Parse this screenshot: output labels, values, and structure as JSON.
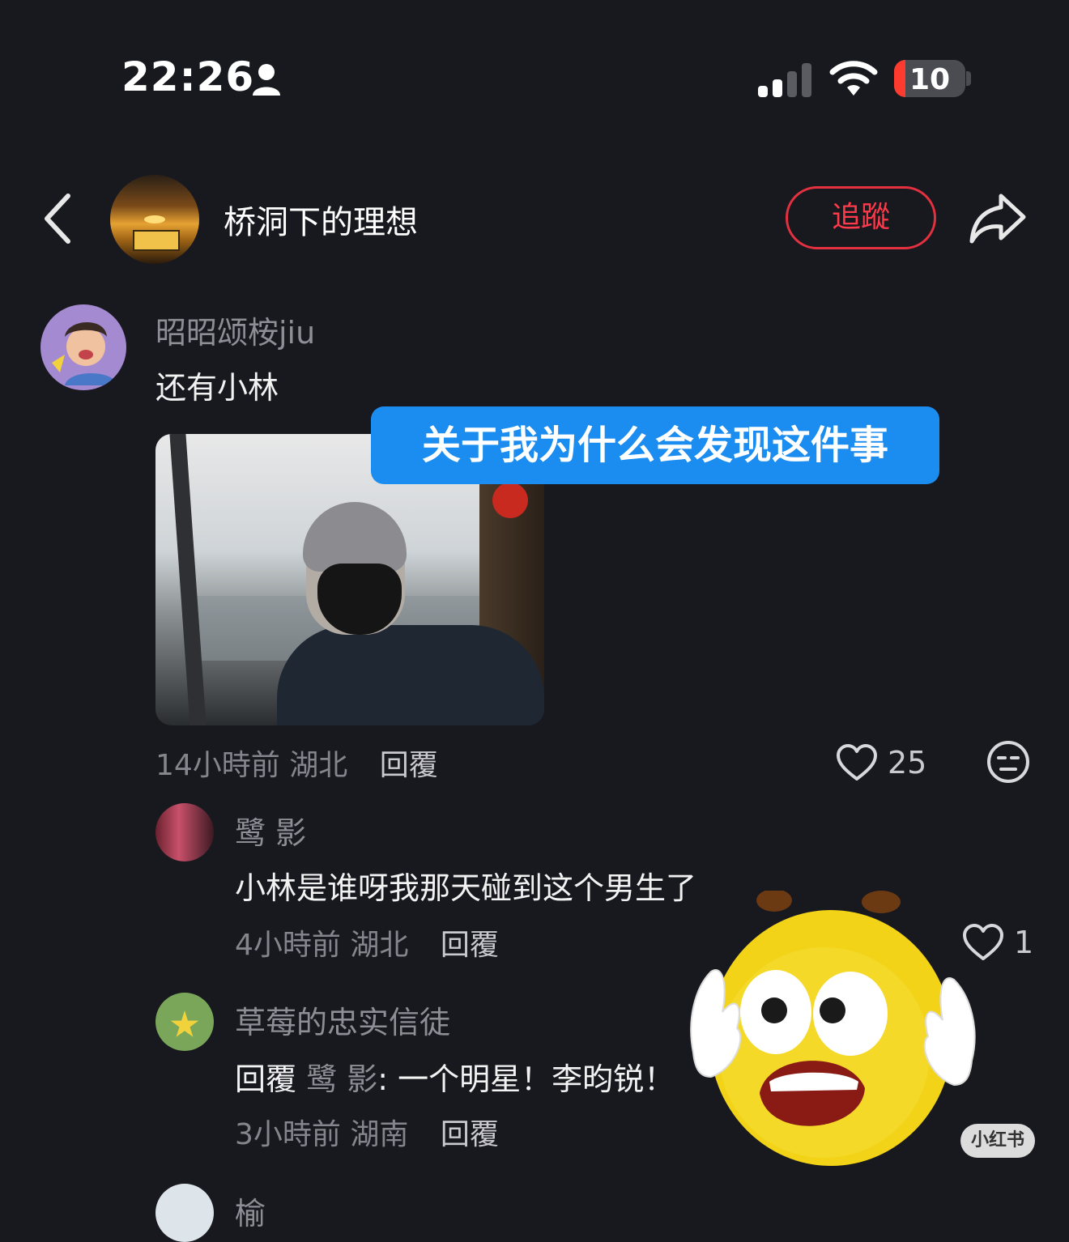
{
  "status_bar": {
    "time": "22:26",
    "battery": "10"
  },
  "header": {
    "title": "桥洞下的理想",
    "follow_label": "追蹤"
  },
  "overlay_caption": "关于我为什么会发现这件事",
  "comment": {
    "username": "昭昭颂桉jiu",
    "text": "还有小林",
    "time": "14小時前",
    "location": "湖北",
    "reply_label": "回覆",
    "likes": "25"
  },
  "replies": [
    {
      "username": "鹭 影",
      "text": "小林是谁呀我那天碰到这个男生了",
      "time": "4小時前",
      "location": "湖北",
      "reply_label": "回覆",
      "likes": "1"
    },
    {
      "username": "草莓的忠实信徒",
      "reply_prefix": "回覆",
      "reply_to": "鹭 影",
      "text": ": 一个明星！李昀锐！",
      "time": "3小時前",
      "location": "湖南",
      "reply_label": "回覆"
    },
    {
      "username": "榆"
    }
  ],
  "watermark": "小红书",
  "colors": {
    "background": "#18181f",
    "accent_red": "#e3313f",
    "caption_blue": "#1c8df0"
  },
  "icons": [
    "back-icon",
    "share-icon",
    "heart-icon",
    "emoji-react-icon",
    "person-icon",
    "signal-icon",
    "wifi-icon",
    "battery-icon"
  ]
}
